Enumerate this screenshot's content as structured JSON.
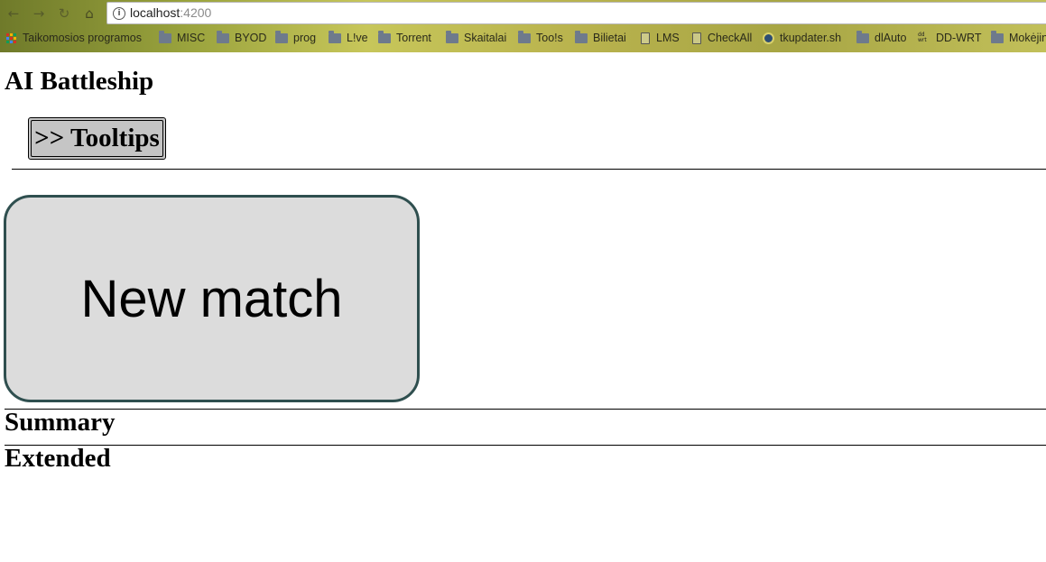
{
  "browser": {
    "url_host": "localhost",
    "url_port": ":4200",
    "bookmarks": [
      {
        "label": "Taikomosios programos",
        "icon": "apps-icon"
      },
      {
        "label": "MISC",
        "icon": "folder-icon"
      },
      {
        "label": "BYOD",
        "icon": "folder-icon"
      },
      {
        "label": "prog",
        "icon": "folder-icon"
      },
      {
        "label": "L!ve",
        "icon": "folder-icon"
      },
      {
        "label": "Torrent",
        "icon": "folder-icon"
      },
      {
        "label": "Skaitalai",
        "icon": "folder-icon"
      },
      {
        "label": "Too!s",
        "icon": "folder-icon"
      },
      {
        "label": "Bilietai",
        "icon": "folder-icon"
      },
      {
        "label": "LMS",
        "icon": "page-icon"
      },
      {
        "label": "CheckAll",
        "icon": "page-icon"
      },
      {
        "label": "tkupdater.sh",
        "icon": "round-icon"
      },
      {
        "label": "dlAuto",
        "icon": "folder-icon"
      },
      {
        "label": "DD-WRT",
        "icon": "router-icon"
      },
      {
        "label": "Mokėjin",
        "icon": "folder-icon"
      }
    ]
  },
  "page": {
    "title": "AI Battleship",
    "tooltips_label": ">> Tooltips",
    "new_match_label": "New match",
    "summary_heading": "Summary",
    "extended_heading": "Extended"
  },
  "colors": {
    "new_match_background": "#dcdcdc",
    "new_match_border": "#2f4f4f",
    "tooltips_background": "#c5c5c5"
  }
}
